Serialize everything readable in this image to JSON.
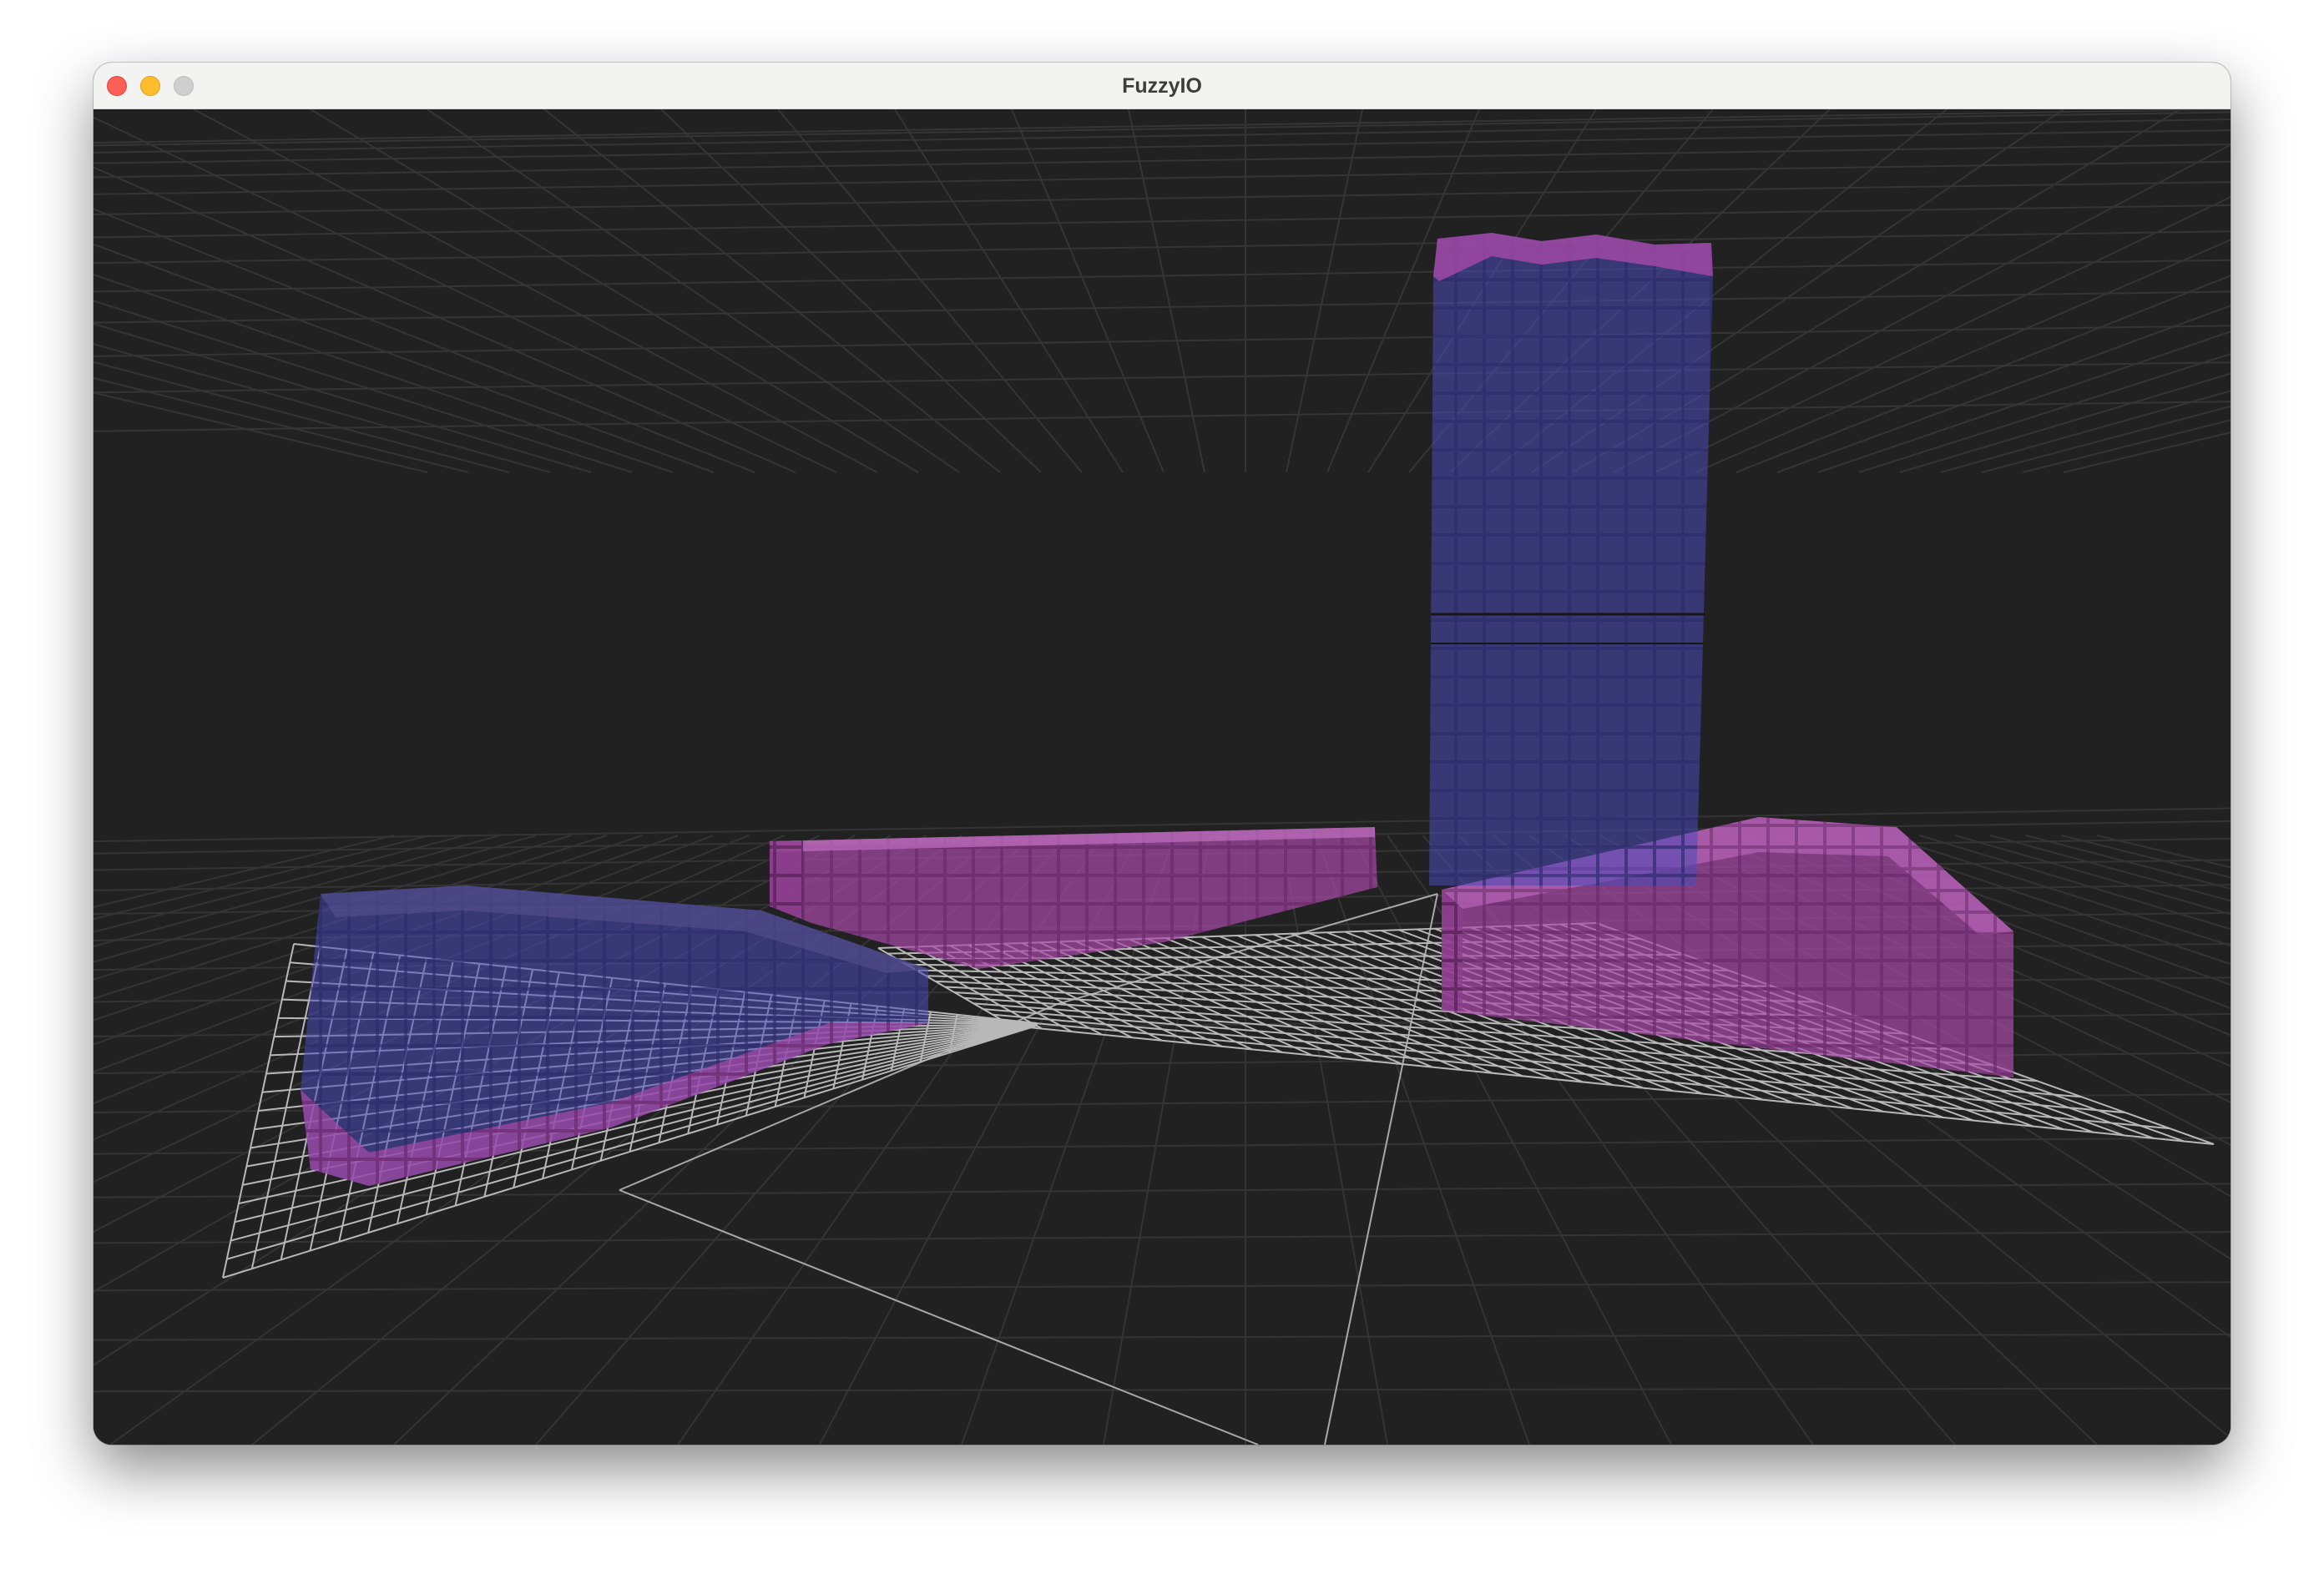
{
  "window": {
    "title": "FuzzyIO",
    "controls": {
      "close": "close-icon",
      "minimize": "minimize-icon",
      "zoom": "zoom-icon"
    }
  },
  "viewport": {
    "background": "#212121",
    "grid_color": "#3a3a3a",
    "wire_color": "#bdbdbd",
    "colors": {
      "blue_voxel": "#4a4ab8",
      "magenta_voxel": "#a84aa8"
    }
  }
}
